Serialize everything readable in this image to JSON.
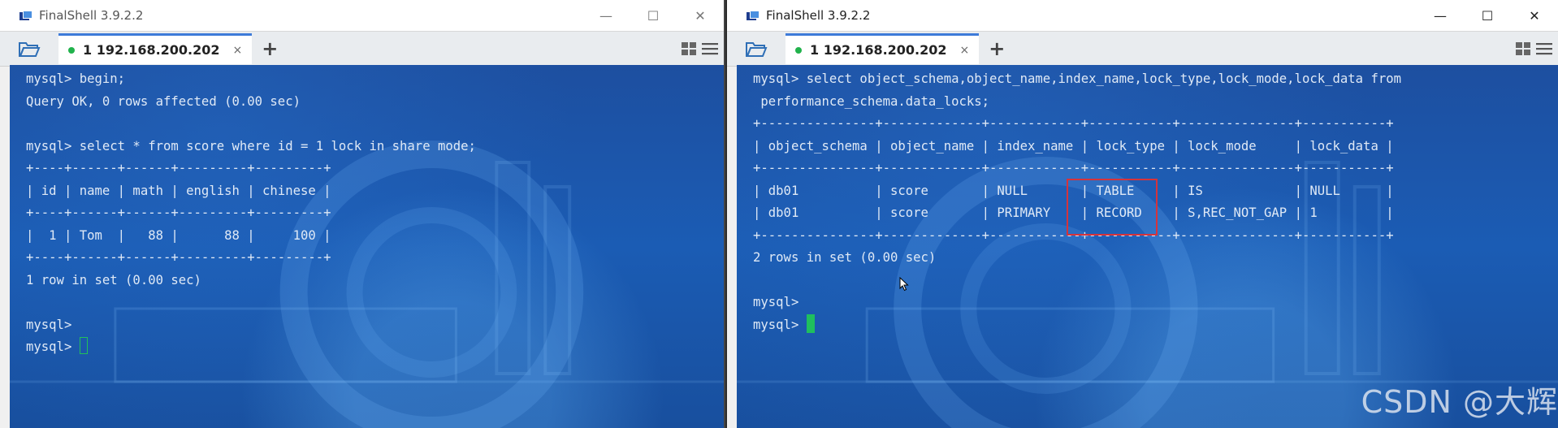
{
  "left_window": {
    "title": "FinalShell 3.9.2.2",
    "tab_label": "1 192.168.200.202",
    "terminal_lines": [
      "mysql> begin;",
      "Query OK, 0 rows affected (0.00 sec)",
      "",
      "mysql> select * from score where id = 1 lock in share mode;",
      "+----+------+------+---------+---------+",
      "| id | name | math | english | chinese |",
      "+----+------+------+---------+---------+",
      "|  1 | Tom  |   88 |      88 |     100 |",
      "+----+------+------+---------+---------+",
      "1 row in set (0.00 sec)",
      "",
      "mysql>",
      "mysql> "
    ]
  },
  "right_window": {
    "title": "FinalShell 3.9.2.2",
    "tab_label": "1 192.168.200.202",
    "terminal_lines": [
      "mysql> select object_schema,object_name,index_name,lock_type,lock_mode,lock_data from",
      " performance_schema.data_locks;",
      "+---------------+-------------+------------+-----------+---------------+-----------+",
      "| object_schema | object_name | index_name | lock_type | lock_mode     | lock_data |",
      "+---------------+-------------+------------+-----------+---------------+-----------+",
      "| db01          | score       | NULL       | TABLE     | IS            | NULL      |",
      "| db01          | score       | PRIMARY    | RECORD    | S,REC_NOT_GAP | 1         |",
      "+---------------+-------------+------------+-----------+---------------+-----------+",
      "2 rows in set (0.00 sec)",
      "",
      "mysql>",
      "mysql> "
    ],
    "watermark": "CSDN @大辉"
  },
  "window_controls": {
    "minimize": "—",
    "maximize": "☐",
    "close": "✕"
  },
  "tab_close_glyph": "×",
  "add_tab_glyph": "+",
  "colors": {
    "terminal_text": "#dfe9f6",
    "cursor": "#1fbf5e",
    "highlight": "#d6333b",
    "tab_accent": "#3d7bd9",
    "connected_dot": "#21b24c"
  }
}
